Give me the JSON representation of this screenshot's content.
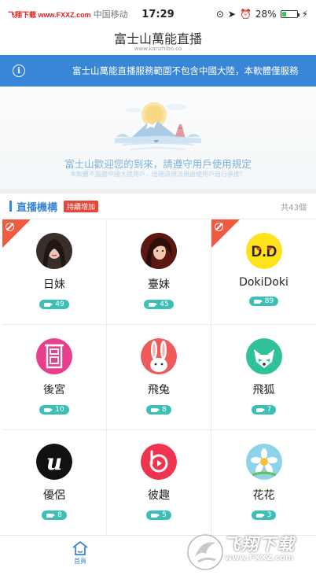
{
  "status_bar": {
    "watermark": "飞翔下载 www.FXXZ.com",
    "carrier": "中国移动",
    "time": "17:29",
    "battery": "28%",
    "battery_level": 0.28
  },
  "header": {
    "title": "富士山萬能直播",
    "subtitle": "www.kanzhibo.co"
  },
  "notice": {
    "text": "富士山萬能直播服務範圍不包含中國大陸，本軟體僅服務"
  },
  "banner": {
    "title": "富士山歡迎您的到來，請遵守用戶使用規定",
    "subtitle": "本軟體不服務中國大陸用戶，出現違規法規由使用戶自行承擔！"
  },
  "section": {
    "title": "直播機構",
    "badge": "持續增加",
    "count": "共43個"
  },
  "platforms": [
    {
      "name": "日妹",
      "count": "49",
      "tagged": true,
      "avatar": "photo-dark"
    },
    {
      "name": "臺妹",
      "count": "45",
      "tagged": false,
      "avatar": "photo-red"
    },
    {
      "name": "DokiDoki",
      "count": "89",
      "tagged": true,
      "avatar": "dokidoki"
    },
    {
      "name": "後宮",
      "count": "10",
      "tagged": false,
      "avatar": "hougong"
    },
    {
      "name": "飛兔",
      "count": "8",
      "tagged": false,
      "avatar": "rabbit"
    },
    {
      "name": "飛狐",
      "count": "7",
      "tagged": false,
      "avatar": "fox"
    },
    {
      "name": "優侶",
      "count": "8",
      "tagged": false,
      "avatar": "u-logo"
    },
    {
      "name": "彼趣",
      "count": "5",
      "tagged": false,
      "avatar": "biqu"
    },
    {
      "name": "花花",
      "count": "3",
      "tagged": false,
      "avatar": "flower"
    }
  ],
  "tab_bar": {
    "home_label": "首頁"
  },
  "corner_watermark": {
    "text": "飞翔下载",
    "url": "www.FXXZ.com"
  },
  "colors": {
    "accent": "#3a86d6",
    "badge": "#e5473b",
    "pill": "#3cbfb6",
    "corner_tag": "#f05a3f"
  }
}
